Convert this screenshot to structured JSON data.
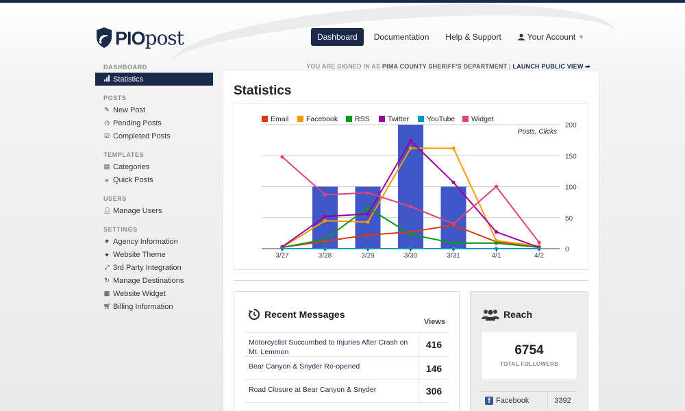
{
  "logo": {
    "part1": "PIO",
    "part2": "post"
  },
  "nav": {
    "items": [
      {
        "label": "Dashboard",
        "active": true
      },
      {
        "label": "Documentation"
      },
      {
        "label": "Help & Support"
      },
      {
        "label": "Your Account"
      }
    ]
  },
  "signed_in": {
    "prefix": "YOU ARE SIGNED IN AS",
    "dept": "PIMA COUNTY SHERIFF'S DEPARTMENT",
    "sep": "|",
    "launch": "LAUNCH PUBLIC VIEW",
    "launch_icon": "share-arrow-icon"
  },
  "sidebar": {
    "sections": [
      {
        "heading": "DASHBOARD",
        "items": [
          {
            "label": "Statistics",
            "icon": "bar-chart-icon",
            "active": true
          }
        ]
      },
      {
        "heading": "POSTS",
        "items": [
          {
            "label": "New Post",
            "icon": "pencil-icon"
          },
          {
            "label": "Pending Posts",
            "icon": "clock-icon"
          },
          {
            "label": "Completed Posts",
            "icon": "check-square-icon"
          }
        ]
      },
      {
        "heading": "TEMPLATES",
        "items": [
          {
            "label": "Categories",
            "icon": "list-box-icon"
          },
          {
            "label": "Quick Posts",
            "icon": "lines-icon"
          }
        ]
      },
      {
        "heading": "USERS",
        "items": [
          {
            "label": "Manage Users",
            "icon": "user-icon"
          }
        ]
      },
      {
        "heading": "SETTINGS",
        "items": [
          {
            "label": "Agency Information",
            "icon": "star-icon"
          },
          {
            "label": "Website Theme",
            "icon": "heart-icon"
          },
          {
            "label": "3rd Party Integration",
            "icon": "expand-icon"
          },
          {
            "label": "Manage Destinations",
            "icon": "share-icon"
          },
          {
            "label": "Website Widget",
            "icon": "grid-icon"
          },
          {
            "label": "Billing Information",
            "icon": "cart-icon"
          }
        ]
      }
    ]
  },
  "main": {
    "title": "Statistics"
  },
  "chart_data": {
    "type": "bar",
    "categories": [
      "3/27",
      "3/28",
      "3/29",
      "3/30",
      "3/31",
      "4/1",
      "4/2"
    ],
    "bar_series": {
      "values": [
        0,
        100,
        100,
        200,
        100,
        0,
        0
      ],
      "color": "#3f57c8"
    },
    "series": [
      {
        "name": "Email",
        "color": "#dc3912",
        "values": [
          2,
          12,
          22,
          27,
          38,
          11,
          4
        ]
      },
      {
        "name": "Facebook",
        "color": "#ff9900",
        "values": [
          2,
          45,
          43,
          162,
          162,
          13,
          4
        ]
      },
      {
        "name": "RSS",
        "color": "#109618",
        "values": [
          2,
          15,
          66,
          23,
          9,
          9,
          2
        ]
      },
      {
        "name": "Twitter",
        "color": "#990099",
        "values": [
          3,
          52,
          56,
          174,
          107,
          27,
          2
        ]
      },
      {
        "name": "YouTube",
        "color": "#0099c6",
        "values": [
          0,
          0,
          0,
          0,
          0,
          0,
          0
        ]
      },
      {
        "name": "Widget",
        "color": "#dd4477",
        "values": [
          148,
          87,
          90,
          68,
          40,
          100,
          10
        ]
      }
    ],
    "ylabel": "Posts, Clicks",
    "ylim": [
      0,
      200
    ],
    "yticks": [
      0,
      50,
      100,
      150,
      200
    ],
    "legend": "top",
    "grid": true
  },
  "recent": {
    "title": "Recent Messages",
    "views_label": "Views",
    "messages": [
      {
        "text": "Motorcyclist Succumbed to Injuries After Crash on Mt. Lemmon",
        "views": "416"
      },
      {
        "text": "Bear Canyon & Snyder Re-opened",
        "views": "146"
      },
      {
        "text": "Road Closure at Bear Canyon & Snyder",
        "views": "306"
      }
    ]
  },
  "reach": {
    "title": "Reach",
    "followers": "6754",
    "followers_label": "TOTAL FOLLOWERS",
    "facebook_label": "Facebook",
    "facebook_count": "3392"
  }
}
